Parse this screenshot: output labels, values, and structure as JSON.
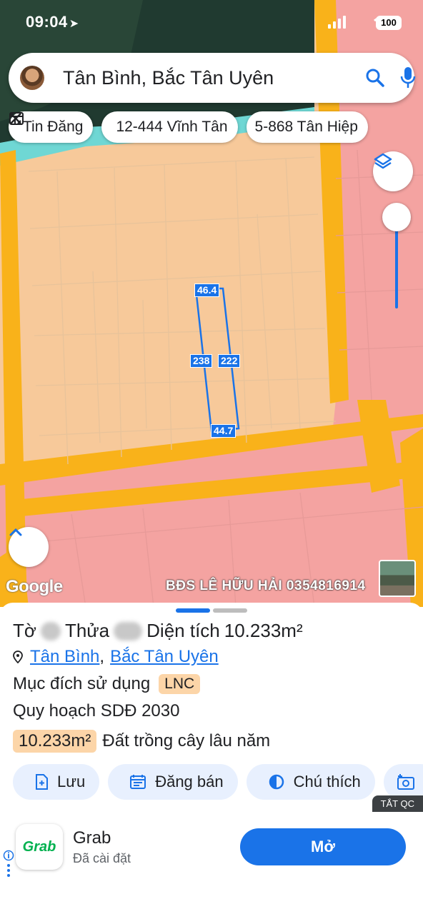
{
  "status_bar": {
    "time": "09:04",
    "battery": "100"
  },
  "search": {
    "query": "Tân Bình, Bắc Tân Uyên"
  },
  "chips": [
    {
      "label": "Tin Đăng",
      "icon": "listing-icon"
    },
    {
      "label": "12-444 Vĩnh Tân",
      "icon": "pattern-icon"
    },
    {
      "label": "5-868 Tân Hiệp",
      "icon": ""
    }
  ],
  "map": {
    "parcel_labels": {
      "top": "46.4",
      "left": "238",
      "right": "222",
      "bottom": "44.7"
    },
    "google_logo": "Google",
    "watermark": "BĐS LÊ HỮU HẢI 0354816914"
  },
  "sheet": {
    "to_label": "Tờ",
    "thua_label": "Thửa",
    "dien_tich_label": "Diện tích",
    "dien_tich_value": "10.233m²",
    "location_ward": "Tân Bình",
    "location_district": "Bắc Tân Uyên",
    "muc_dich_label": "Mục đích sử dụng",
    "muc_dich_value": "LNC",
    "quy_hoach_label": "Quy hoạch SDĐ 2030",
    "quy_hoach_area": "10.233m²",
    "quy_hoach_type": "Đất trồng cây lâu năm",
    "actions": [
      {
        "label": "Lưu",
        "icon": "save-icon"
      },
      {
        "label": "Đăng bán",
        "icon": "post-sale-icon"
      },
      {
        "label": "Chú thích",
        "icon": "legend-icon"
      }
    ]
  },
  "ad": {
    "tag": "TẮT QC",
    "logo_text": "Grab",
    "app_name": "Grab",
    "subtitle": "Đã cài đặt",
    "button": "Mở"
  },
  "colors": {
    "accent": "#1a73e8",
    "zone_orange": "#f7c99a",
    "zone_pink": "#f4a3a1",
    "road": "#f9b21a"
  }
}
